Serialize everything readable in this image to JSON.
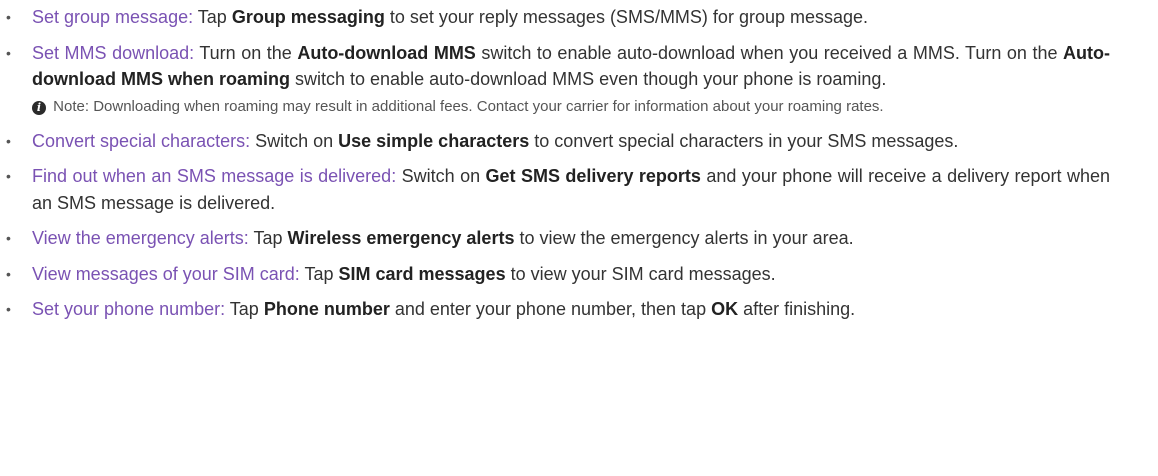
{
  "items": [
    {
      "topic": "Set group message:",
      "t1": " Tap ",
      "b1": "Group messaging",
      "t2": " to set your reply messages (SMS/MMS) for group message."
    },
    {
      "topic": "Set MMS download:",
      "t1": " Turn on the ",
      "b1": "Auto-download MMS",
      "t2": " switch to enable auto-download when you received a MMS. Turn on the ",
      "b2": "Auto-download MMS when roaming",
      "t3": " switch to enable auto-download MMS even though your phone is roaming.",
      "note": "Note: Downloading when roaming may result in additional fees. Contact your carrier for information about your roaming rates."
    },
    {
      "topic": "Convert special characters:",
      "t1": " Switch on ",
      "b1": "Use simple characters",
      "t2": " to convert special characters in your SMS messages."
    },
    {
      "topic": "Find out when an SMS message is delivered:",
      "t1": " Switch on ",
      "b1": "Get SMS delivery reports",
      "t2": " and your phone will receive a delivery report when an SMS message is delivered."
    },
    {
      "topic": "View the emergency alerts:",
      "t1": " Tap ",
      "b1": "Wireless emergency alerts",
      "t2": " to view the emergency alerts in your area."
    },
    {
      "topic": "View messages of your SIM card:",
      "t1": " Tap ",
      "b1": "SIM card messages",
      "t2": " to view your SIM card messages."
    },
    {
      "topic": "Set your phone number:",
      "t1": " Tap ",
      "b1": "Phone number",
      "t2": " and enter your phone number, then tap ",
      "b2": "OK",
      "t3": " after finishing."
    }
  ],
  "bullet_char": "•",
  "note_icon_glyph": "i",
  "colors": {
    "topic": "#7a52b3",
    "body_text": "#333333",
    "note_text": "#555555"
  }
}
